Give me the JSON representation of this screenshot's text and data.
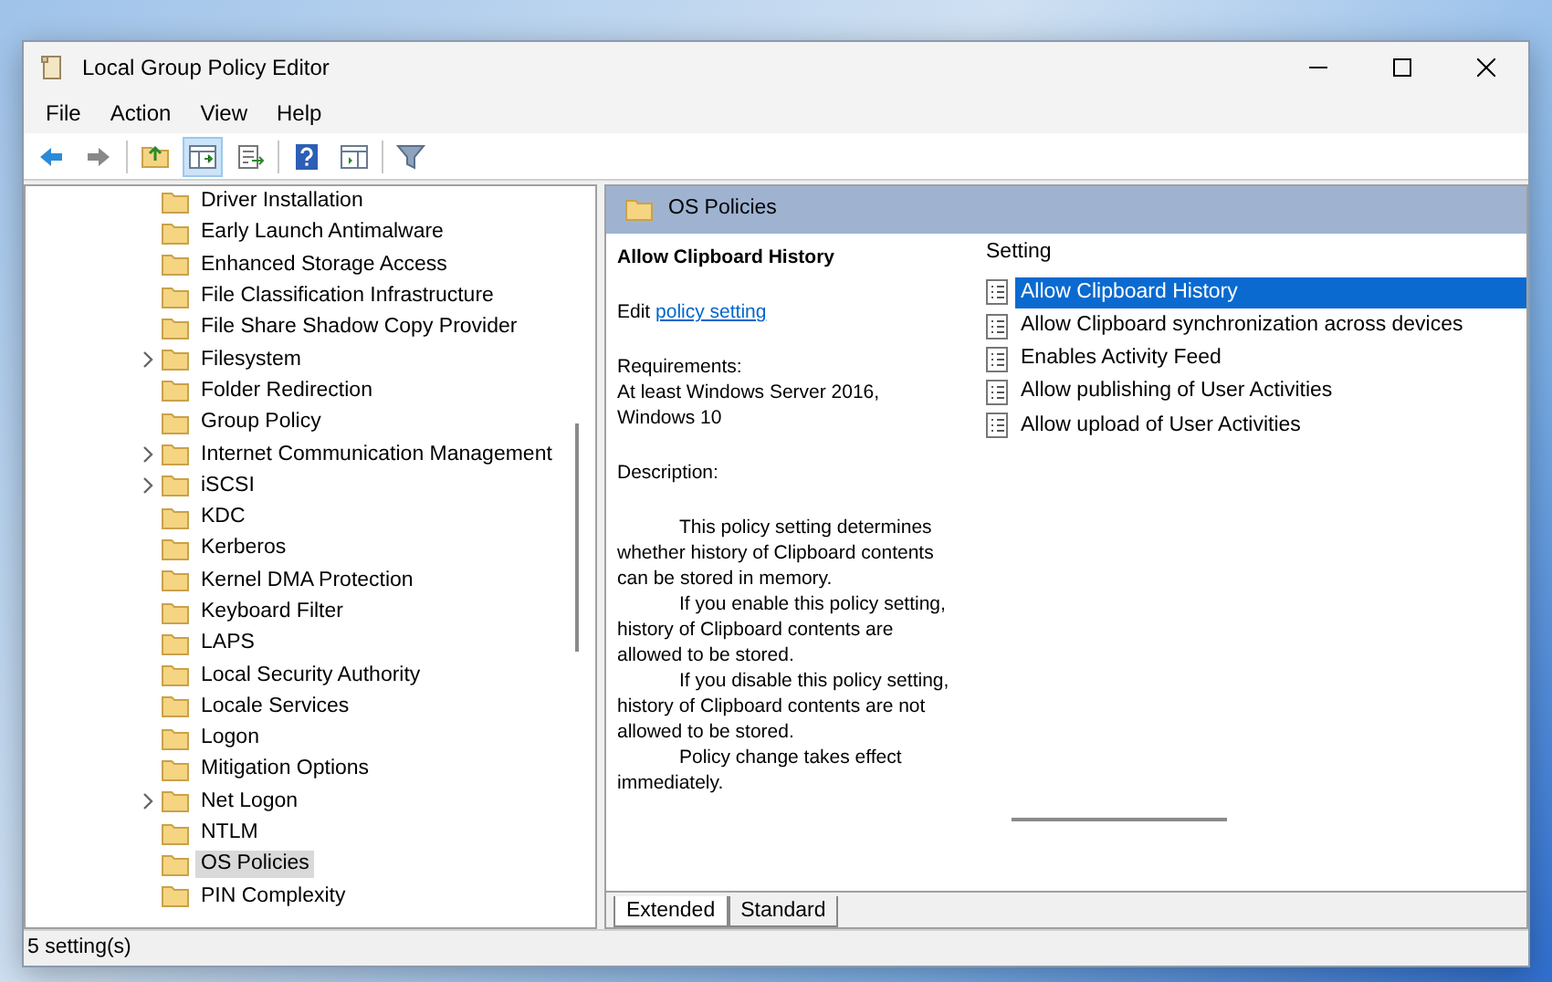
{
  "window": {
    "title": "Local Group Policy Editor"
  },
  "menu": [
    "File",
    "Action",
    "View",
    "Help"
  ],
  "toolbar": [
    {
      "kind": "back",
      "pressed": false
    },
    {
      "kind": "forward",
      "pressed": false
    },
    {
      "kind": "up",
      "pressed": false
    },
    {
      "kind": "tree",
      "pressed": true
    },
    {
      "kind": "export",
      "pressed": false
    },
    {
      "kind": "help",
      "pressed": false
    },
    {
      "kind": "view",
      "pressed": false
    },
    {
      "kind": "filter",
      "pressed": false
    }
  ],
  "tree": [
    {
      "label": "Driver Installation",
      "expandable": false,
      "selected": false
    },
    {
      "label": "Early Launch Antimalware",
      "expandable": false,
      "selected": false
    },
    {
      "label": "Enhanced Storage Access",
      "expandable": false,
      "selected": false
    },
    {
      "label": "File Classification Infrastructure",
      "expandable": false,
      "selected": false
    },
    {
      "label": "File Share Shadow Copy Provider",
      "expandable": false,
      "selected": false
    },
    {
      "label": "Filesystem",
      "expandable": true,
      "selected": false
    },
    {
      "label": "Folder Redirection",
      "expandable": false,
      "selected": false
    },
    {
      "label": "Group Policy",
      "expandable": false,
      "selected": false
    },
    {
      "label": "Internet Communication Management",
      "expandable": true,
      "selected": false
    },
    {
      "label": "iSCSI",
      "expandable": true,
      "selected": false
    },
    {
      "label": "KDC",
      "expandable": false,
      "selected": false
    },
    {
      "label": "Kerberos",
      "expandable": false,
      "selected": false
    },
    {
      "label": "Kernel DMA Protection",
      "expandable": false,
      "selected": false
    },
    {
      "label": "Keyboard Filter",
      "expandable": false,
      "selected": false
    },
    {
      "label": "LAPS",
      "expandable": false,
      "selected": false
    },
    {
      "label": "Local Security Authority",
      "expandable": false,
      "selected": false
    },
    {
      "label": "Locale Services",
      "expandable": false,
      "selected": false
    },
    {
      "label": "Logon",
      "expandable": false,
      "selected": false
    },
    {
      "label": "Mitigation Options",
      "expandable": false,
      "selected": false
    },
    {
      "label": "Net Logon",
      "expandable": true,
      "selected": false
    },
    {
      "label": "NTLM",
      "expandable": false,
      "selected": false
    },
    {
      "label": "OS Policies",
      "expandable": false,
      "selected": true
    },
    {
      "label": "PIN Complexity",
      "expandable": false,
      "selected": false
    }
  ],
  "details": {
    "header": "OS Policies",
    "policy_title": "Allow Clipboard History",
    "edit_prefix": "Edit",
    "edit_link": "policy setting",
    "requirements_label": "Requirements:",
    "requirements": "At least Windows Server 2016, Windows 10",
    "description_label": "Description:",
    "description": [
      "This policy setting determines whether history of Clipboard contents can be stored in memory.",
      "If you enable this policy setting, history of Clipboard contents are allowed to be stored.",
      "If you disable this policy setting, history of Clipboard contents are not allowed to be stored.",
      "Policy change takes effect immediately."
    ]
  },
  "settings": {
    "column": "Setting",
    "rows": [
      {
        "label": "Allow Clipboard History",
        "selected": true
      },
      {
        "label": "Allow Clipboard synchronization across devices",
        "selected": false
      },
      {
        "label": "Enables Activity Feed",
        "selected": false
      },
      {
        "label": "Allow publishing of User Activities",
        "selected": false
      },
      {
        "label": "Allow upload of User Activities",
        "selected": false
      }
    ]
  },
  "tabs": [
    {
      "label": "Extended",
      "selected": true
    },
    {
      "label": "Standard",
      "selected": false
    }
  ],
  "status_bar": "5 setting(s)"
}
